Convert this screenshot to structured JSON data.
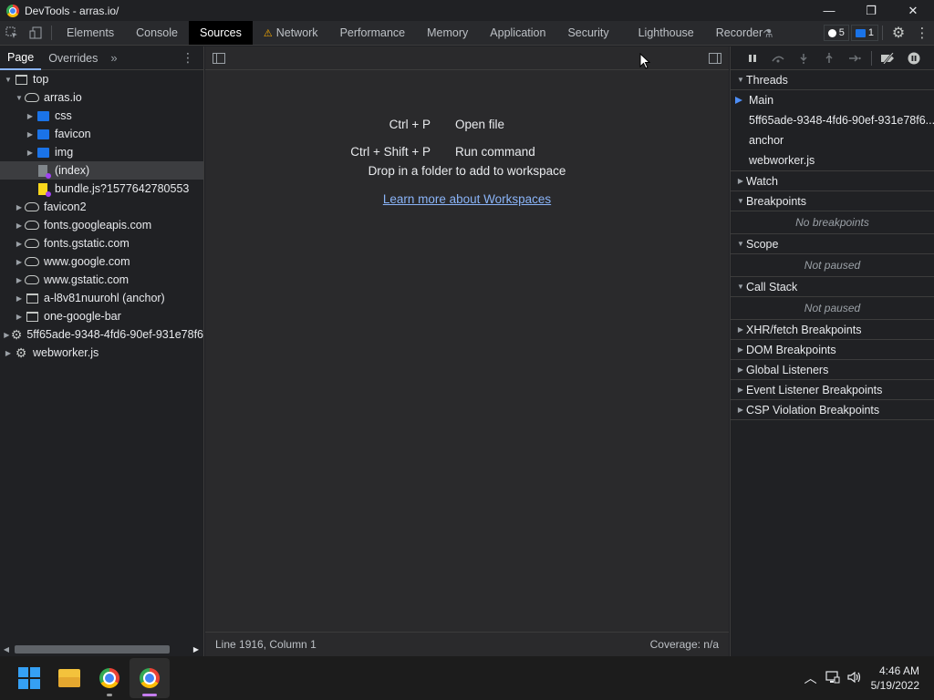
{
  "window": {
    "title": "DevTools - arras.io/",
    "controls": {
      "minimize": "—",
      "restore": "❐",
      "close": "✕"
    }
  },
  "toolbar": {
    "tabs": [
      {
        "label": "Elements"
      },
      {
        "label": "Console"
      },
      {
        "label": "Sources",
        "active": true
      },
      {
        "label": "Network",
        "warning": true
      },
      {
        "label": "Performance"
      },
      {
        "label": "Memory"
      },
      {
        "label": "Application"
      },
      {
        "label": "Security"
      },
      {
        "label": "Lighthouse"
      },
      {
        "label": "Recorder"
      }
    ],
    "issues_count": "5",
    "messages_count": "1"
  },
  "navigator": {
    "tabs": [
      "Page",
      "Overrides"
    ],
    "more": "»",
    "tree": [
      {
        "label": "top",
        "icon": "frame",
        "depth": 0,
        "expanded": true
      },
      {
        "label": "arras.io",
        "icon": "cloud",
        "depth": 1,
        "expanded": true
      },
      {
        "label": "css",
        "icon": "folder",
        "depth": 2,
        "expanded": false
      },
      {
        "label": "favicon",
        "icon": "folder",
        "depth": 2,
        "expanded": false
      },
      {
        "label": "img",
        "icon": "folder",
        "depth": 2,
        "expanded": false
      },
      {
        "label": "(index)",
        "icon": "file",
        "depth": 2,
        "selected": true
      },
      {
        "label": "bundle.js?1577642780553",
        "icon": "js-file",
        "depth": 2
      },
      {
        "label": "favicon2",
        "icon": "cloud",
        "depth": 1,
        "expanded": false
      },
      {
        "label": "fonts.googleapis.com",
        "icon": "cloud",
        "depth": 1,
        "expanded": false
      },
      {
        "label": "fonts.gstatic.com",
        "icon": "cloud",
        "depth": 1,
        "expanded": false
      },
      {
        "label": "www.google.com",
        "icon": "cloud",
        "depth": 1,
        "expanded": false
      },
      {
        "label": "www.gstatic.com",
        "icon": "cloud",
        "depth": 1,
        "expanded": false
      },
      {
        "label": "a-l8v81nuurohl (anchor)",
        "icon": "frame",
        "depth": 1,
        "expanded": false
      },
      {
        "label": "one-google-bar",
        "icon": "frame",
        "depth": 1,
        "expanded": false
      },
      {
        "label": "5ff65ade-9348-4fd6-90ef-931e78f6",
        "icon": "gear",
        "depth": 0,
        "expanded": false
      },
      {
        "label": "webworker.js",
        "icon": "gear",
        "depth": 0,
        "expanded": false
      }
    ]
  },
  "editor": {
    "shortcuts": [
      {
        "keys": "Ctrl + P",
        "label": "Open file"
      },
      {
        "keys": "Ctrl + Shift + P",
        "label": "Run command"
      }
    ],
    "drop_text": "Drop in a folder to add to workspace",
    "learn_link": "Learn more about Workspaces",
    "status_position": "Line 1916, Column 1",
    "status_coverage": "Coverage: n/a"
  },
  "debugger": {
    "threads_label": "Threads",
    "threads": [
      {
        "label": "Main",
        "current": true
      },
      {
        "label": "5ff65ade-9348-4fd6-90ef-931e78f6..."
      },
      {
        "label": "anchor"
      },
      {
        "label": "webworker.js"
      }
    ],
    "sections": [
      {
        "label": "Watch",
        "expanded": false
      },
      {
        "label": "Breakpoints",
        "expanded": true,
        "placeholder": "No breakpoints"
      },
      {
        "label": "Scope",
        "expanded": true,
        "placeholder": "Not paused"
      },
      {
        "label": "Call Stack",
        "expanded": true,
        "placeholder": "Not paused"
      },
      {
        "label": "XHR/fetch Breakpoints",
        "expanded": false
      },
      {
        "label": "DOM Breakpoints",
        "expanded": false
      },
      {
        "label": "Global Listeners",
        "expanded": false
      },
      {
        "label": "Event Listener Breakpoints",
        "expanded": false
      },
      {
        "label": "CSP Violation Breakpoints",
        "expanded": false
      }
    ]
  },
  "taskbar": {
    "clock_time": "4:46 AM",
    "clock_date": "5/19/2022"
  },
  "colors": {
    "accent": "#8ab4f8",
    "folder": "#1a73e8",
    "warning": "#f9ab00"
  }
}
